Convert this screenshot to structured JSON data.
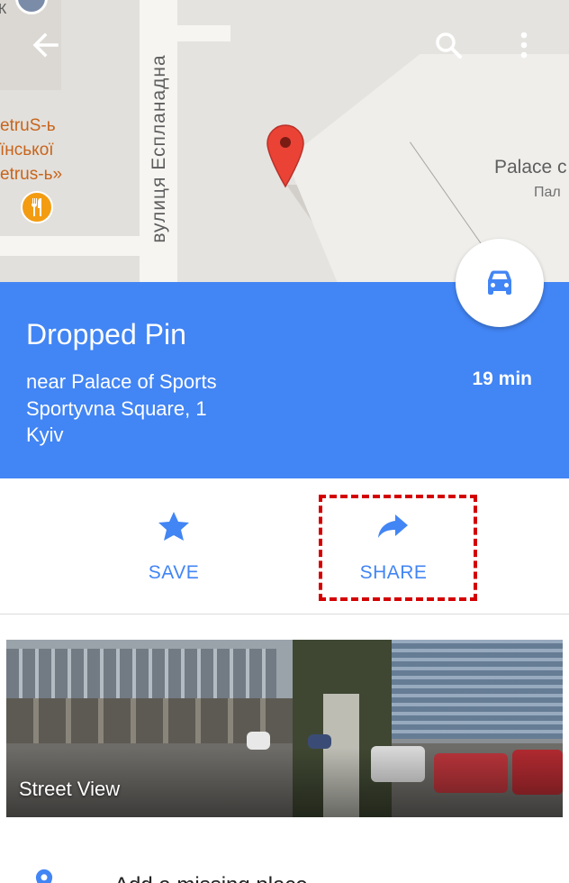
{
  "map": {
    "street_label": "вулиця Еспланадна",
    "poi_lines": [
      "etruS-ь",
      "їнської",
      "etrus-ь»"
    ],
    "palace_label": "Palace c",
    "palace_label_secondary": "Пал",
    "top_left_label": "К",
    "icons": {
      "back": "arrow-back-icon",
      "search": "search-icon",
      "more": "more-vert-icon",
      "pin": "map-pin-icon",
      "restaurant": "restaurant-icon"
    }
  },
  "place": {
    "title": "Dropped Pin",
    "address_lines": [
      "near Palace of Sports",
      "Sportyvna Square, 1",
      "Kyiv"
    ],
    "eta": "19 min",
    "directions_icon": "car-icon"
  },
  "actions": [
    {
      "label": "SAVE",
      "icon": "star-icon"
    },
    {
      "label": "SHARE",
      "icon": "share-icon"
    }
  ],
  "street_view": {
    "label": "Street View"
  },
  "address_row": {
    "text": "Add a missing place",
    "icon": "location-icon"
  },
  "colors": {
    "accent": "#4285f4",
    "header_bg": "#4285f4",
    "pin": "#ea4335",
    "highlight": "#d40000"
  }
}
